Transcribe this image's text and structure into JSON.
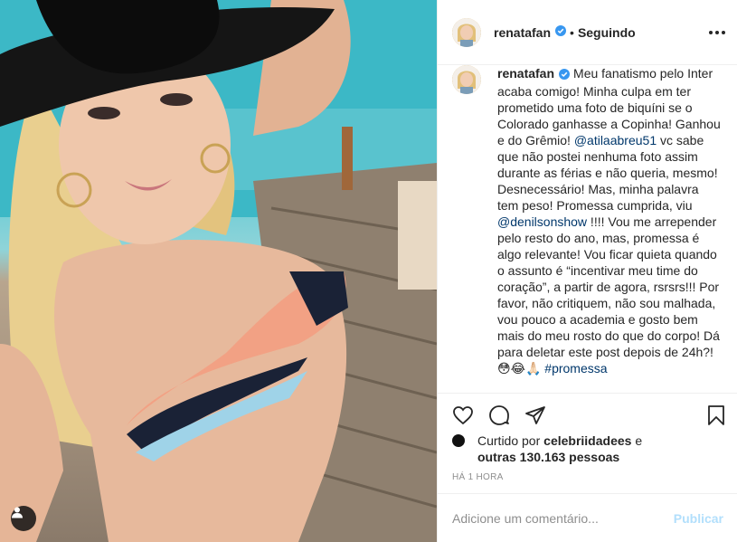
{
  "post": {
    "username": "renatafan",
    "follow_status": "Seguindo",
    "dot": "•",
    "caption": {
      "username": "renatafan",
      "part1": "Meu fanatismo pelo Inter acaba comigo! Minha culpa em ter prometido uma foto de biquíni se o Colorado ganhasse a Copinha! Ganhou e do Grêmio! ",
      "mention1": "@atilaabreu51",
      "part2": " vc sabe que não postei nenhuma foto assim durante as férias e não queria, mesmo! Desnecessário! Mas, minha palavra tem peso! Promessa cumprida, viu ",
      "mention2": "@denilsonshow",
      "part3": " !!!! Vou me arrepender pelo resto do ano, mas, promessa é algo relevante! Vou ficar quieta quando o assunto é “incentivar meu time do coração”, a partir de agora, rsrsrs!!! Por favor, não critiquem, não sou malhada, vou pouco a academia e gosto bem mais do meu rosto do que do corpo! Dá para deletar este post depois de 24h?! 😳😂🙏🏻 ",
      "hashtag": "#promessa"
    },
    "likes": {
      "prefix": "Curtido por ",
      "liker": "celebriidadees",
      "middle": " e",
      "others": "outras 130.163 pessoas"
    },
    "time_ago": "HÁ 1 HORA",
    "comment_placeholder": "Adicione um comentário...",
    "publish_label": "Publicar"
  },
  "icons": {
    "header_more": "more-options-icon",
    "like": "heart-icon",
    "comment": "comment-icon",
    "share": "share-icon",
    "save": "bookmark-icon",
    "verified": "verified-badge-icon",
    "user_tag": "user-tag-icon"
  },
  "colors": {
    "verified": "#3897f0",
    "link": "#00376b",
    "muted": "#8e8e8e",
    "publish_disabled": "#b2dffc"
  }
}
